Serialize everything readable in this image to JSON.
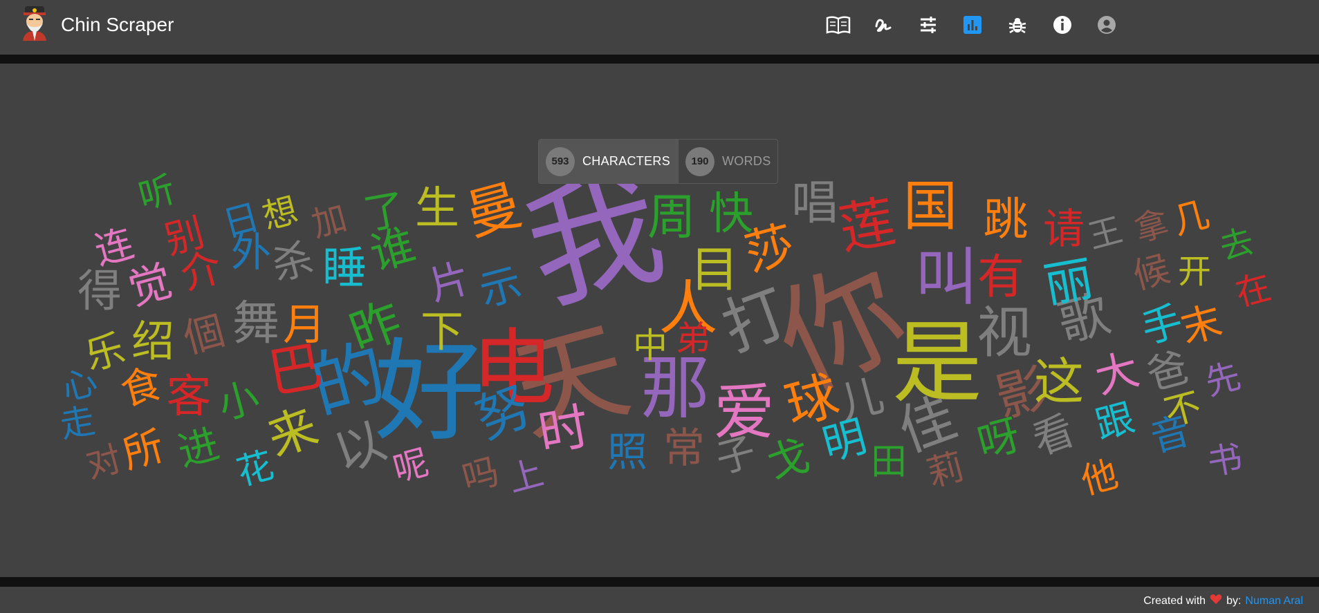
{
  "app": {
    "title": "Chin Scraper"
  },
  "nav": {
    "icons": [
      {
        "name": "book-icon",
        "active": false
      },
      {
        "name": "signature-icon",
        "active": false
      },
      {
        "name": "sliders-icon",
        "active": false
      },
      {
        "name": "bar-chart-icon",
        "active": true
      },
      {
        "name": "bug-icon",
        "active": false
      },
      {
        "name": "info-icon",
        "active": false
      },
      {
        "name": "account-icon",
        "active": false
      }
    ],
    "active_color": "#2196f3"
  },
  "toggle": {
    "characters": {
      "count": "593",
      "label": "CHARACTERS"
    },
    "words": {
      "count": "190",
      "label": "WORDS"
    }
  },
  "cloud_words": [
    {
      "t": "我",
      "c": "#9467bd"
    },
    {
      "t": "你",
      "c": "#8c564b"
    },
    {
      "t": "天",
      "c": "#8c564b"
    },
    {
      "t": "好",
      "c": "#1f77b4"
    },
    {
      "t": "是",
      "c": "#bcbd22"
    },
    {
      "t": "电",
      "c": "#d62728"
    },
    {
      "t": "的",
      "c": "#1f77b4"
    },
    {
      "t": "那",
      "c": "#9467bd"
    },
    {
      "t": "爱",
      "c": "#e377c2"
    },
    {
      "t": "叫",
      "c": "#9467bd"
    },
    {
      "t": "人",
      "c": "#ff7f0e"
    },
    {
      "t": "打",
      "c": "#7f7f7f"
    },
    {
      "t": "莲",
      "c": "#d62728"
    },
    {
      "t": "国",
      "c": "#ff7f0e"
    },
    {
      "t": "球",
      "c": "#ff7f0e"
    },
    {
      "t": "巴",
      "c": "#d62728"
    },
    {
      "t": "视",
      "c": "#7f7f7f"
    },
    {
      "t": "影",
      "c": "#8c564b"
    },
    {
      "t": "这",
      "c": "#bcbd22"
    },
    {
      "t": "歌",
      "c": "#7f7f7f"
    },
    {
      "t": "努",
      "c": "#1f77b4"
    },
    {
      "t": "目",
      "c": "#bcbd22"
    },
    {
      "t": "以",
      "c": "#7f7f7f"
    },
    {
      "t": "时",
      "c": "#e377c2"
    },
    {
      "t": "常",
      "c": "#8c564b"
    },
    {
      "t": "佳",
      "c": "#7f7f7f"
    },
    {
      "t": "有",
      "c": "#d62728"
    },
    {
      "t": "丽",
      "c": "#17becf"
    },
    {
      "t": "跳",
      "c": "#ff7f0e"
    },
    {
      "t": "请",
      "c": "#d62728"
    },
    {
      "t": "曼",
      "c": "#ff7f0e"
    },
    {
      "t": "莎",
      "c": "#ff7f0e"
    },
    {
      "t": "周",
      "c": "#2ca02c"
    },
    {
      "t": "快",
      "c": "#2ca02c"
    },
    {
      "t": "唱",
      "c": "#7f7f7f"
    },
    {
      "t": "月",
      "c": "#ff7f0e"
    },
    {
      "t": "昨",
      "c": "#2ca02c"
    },
    {
      "t": "舞",
      "c": "#7f7f7f"
    },
    {
      "t": "来",
      "c": "#bcbd22"
    },
    {
      "t": "睡",
      "c": "#17becf"
    },
    {
      "t": "谁",
      "c": "#2ca02c"
    },
    {
      "t": "示",
      "c": "#1f77b4"
    },
    {
      "t": "片",
      "c": "#9467bd"
    },
    {
      "t": "下",
      "c": "#bcbd22"
    },
    {
      "t": "生",
      "c": "#bcbd22"
    },
    {
      "t": "了",
      "c": "#2ca02c"
    },
    {
      "t": "儿",
      "c": "#7f7f7f"
    },
    {
      "t": "看",
      "c": "#7f7f7f"
    },
    {
      "t": "呀",
      "c": "#2ca02c"
    },
    {
      "t": "明",
      "c": "#17becf"
    },
    {
      "t": "戈",
      "c": "#2ca02c"
    },
    {
      "t": "照",
      "c": "#1f77b4"
    },
    {
      "t": "子",
      "c": "#7f7f7f"
    },
    {
      "t": "田",
      "c": "#2ca02c"
    },
    {
      "t": "莉",
      "c": "#8c564b"
    },
    {
      "t": "大",
      "c": "#e377c2"
    },
    {
      "t": "手",
      "c": "#17becf"
    },
    {
      "t": "末",
      "c": "#ff7f0e"
    },
    {
      "t": "爸",
      "c": "#7f7f7f"
    },
    {
      "t": "跟",
      "c": "#17becf"
    },
    {
      "t": "音",
      "c": "#1f77b4"
    },
    {
      "t": "他",
      "c": "#ff7f0e"
    },
    {
      "t": "不",
      "c": "#bcbd22"
    },
    {
      "t": "先",
      "c": "#9467bd"
    },
    {
      "t": "书",
      "c": "#9467bd"
    },
    {
      "t": "在",
      "c": "#d62728"
    },
    {
      "t": "去",
      "c": "#2ca02c"
    },
    {
      "t": "开",
      "c": "#bcbd22"
    },
    {
      "t": "候",
      "c": "#8c564b"
    },
    {
      "t": "拿",
      "c": "#8c564b"
    },
    {
      "t": "几",
      "c": "#ff7f0e"
    },
    {
      "t": "王",
      "c": "#7f7f7f"
    },
    {
      "t": "得",
      "c": "#7f7f7f"
    },
    {
      "t": "觉",
      "c": "#e377c2"
    },
    {
      "t": "介",
      "c": "#d62728"
    },
    {
      "t": "连",
      "c": "#e377c2"
    },
    {
      "t": "别",
      "c": "#d62728"
    },
    {
      "t": "听",
      "c": "#2ca02c"
    },
    {
      "t": "日",
      "c": "#1f77b4"
    },
    {
      "t": "想",
      "c": "#bcbd22"
    },
    {
      "t": "加",
      "c": "#8c564b"
    },
    {
      "t": "外",
      "c": "#1f77b4"
    },
    {
      "t": "杀",
      "c": "#7f7f7f"
    },
    {
      "t": "乐",
      "c": "#bcbd22"
    },
    {
      "t": "绍",
      "c": "#bcbd22"
    },
    {
      "t": "個",
      "c": "#8c564b"
    },
    {
      "t": "心",
      "c": "#1f77b4"
    },
    {
      "t": "食",
      "c": "#ff7f0e"
    },
    {
      "t": "客",
      "c": "#d62728"
    },
    {
      "t": "小",
      "c": "#2ca02c"
    },
    {
      "t": "走",
      "c": "#1f77b4"
    },
    {
      "t": "对",
      "c": "#8c564b"
    },
    {
      "t": "所",
      "c": "#ff7f0e"
    },
    {
      "t": "进",
      "c": "#2ca02c"
    },
    {
      "t": "花",
      "c": "#17becf"
    },
    {
      "t": "呢",
      "c": "#e377c2"
    },
    {
      "t": "吗",
      "c": "#8c564b"
    },
    {
      "t": "上",
      "c": "#9467bd"
    },
    {
      "t": "中",
      "c": "#bcbd22"
    },
    {
      "t": "弟",
      "c": "#d62728"
    }
  ],
  "footer": {
    "prefix": "Created with",
    "suffix": "by:",
    "author": "Numan Aral",
    "heart_color": "#e53935"
  }
}
